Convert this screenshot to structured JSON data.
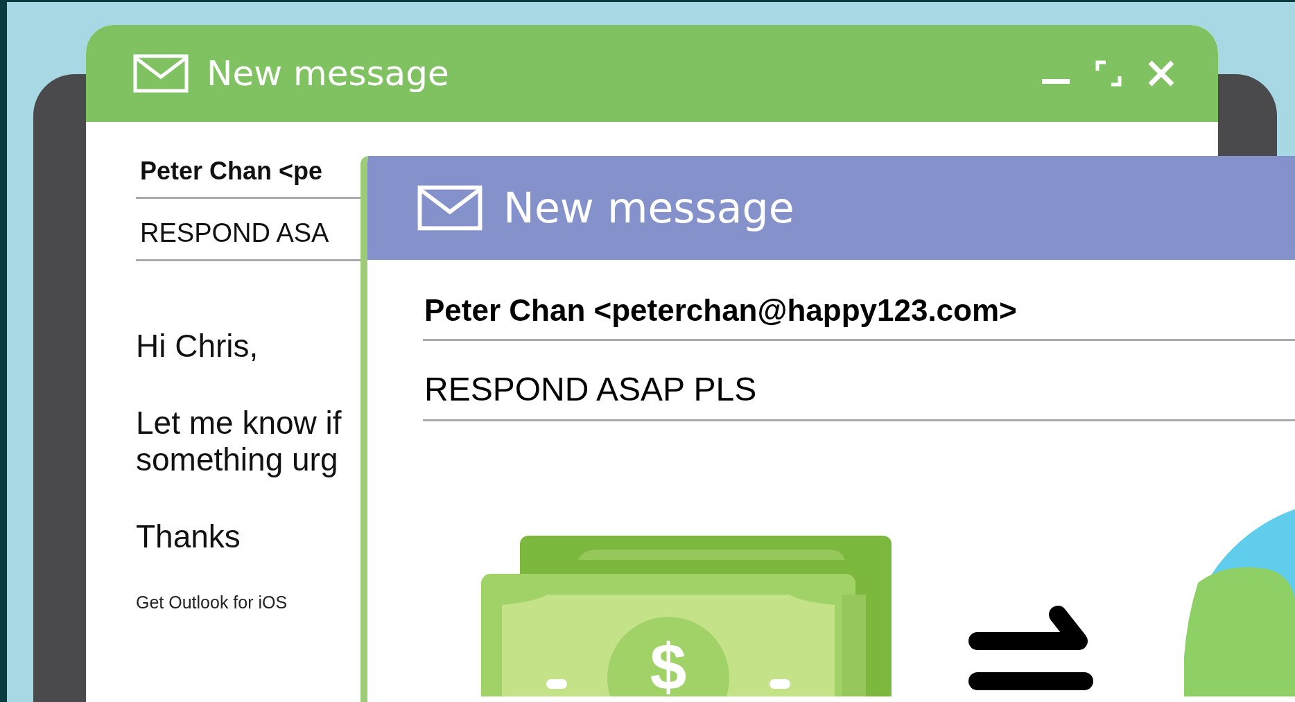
{
  "back_window": {
    "title": "New message",
    "from": "Peter Chan <pe",
    "subject": "RESPOND ASA",
    "body": [
      "Hi Chris,",
      "Let me know if\nsomething urg",
      "Thanks"
    ],
    "signature": "Get Outlook for iOS"
  },
  "front_window": {
    "title": "New message",
    "from": "Peter Chan <peterchan@happy123.com>",
    "subject": "RESPOND ASAP PLS",
    "cash_symbol": "$"
  }
}
